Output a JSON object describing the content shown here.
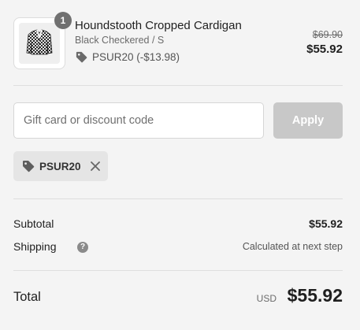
{
  "product": {
    "image_alt": "Houndstooth Cropped Cardigan",
    "quantity": "1",
    "title": "Houndstooth Cropped Cardigan",
    "variant": "Black Checkered / S",
    "discount_line": "PSUR20 (-$13.98)",
    "compare_at_price": "$69.90",
    "price": "$55.92"
  },
  "discount_form": {
    "placeholder": "Gift card or discount code",
    "value": "",
    "apply_label": "Apply"
  },
  "applied_code": {
    "label": "PSUR20",
    "tag_icon": "tag-icon",
    "remove_icon": "close-icon"
  },
  "totals": {
    "subtotal_label": "Subtotal",
    "subtotal_value": "$55.92",
    "shipping_label": "Shipping",
    "shipping_help_icon": "question-icon",
    "shipping_value": "Calculated at next step",
    "total_label": "Total",
    "currency": "USD",
    "total_value": "$55.92"
  },
  "colors": {
    "background": "#f4f4f4",
    "text": "#1f1f1f",
    "muted": "#6b6b6b",
    "badge": "#707070",
    "apply_disabled": "#c8c8c8",
    "chip": "#e5e5e5",
    "divider": "#dedede"
  }
}
